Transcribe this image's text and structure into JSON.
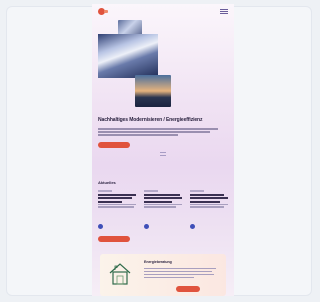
{
  "hero": {
    "title": "Nachhaltiges Modernisieren / Energieeffizienz"
  },
  "news": {
    "title": "Aktuelles"
  },
  "bottom_card": {
    "title": "Energieberatung"
  },
  "colors": {
    "accent": "#e0533d",
    "link_dot": "#3f4fb8",
    "text": "#2b2340"
  }
}
